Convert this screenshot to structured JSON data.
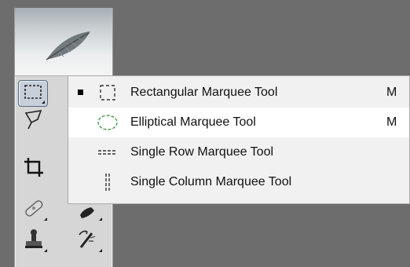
{
  "menu": {
    "items": [
      {
        "label": "Rectangular Marquee Tool",
        "shortcut": "M",
        "active": true
      },
      {
        "label": "Elliptical Marquee Tool",
        "shortcut": "M",
        "active": false
      },
      {
        "label": "Single Row Marquee Tool",
        "shortcut": "",
        "active": false
      },
      {
        "label": "Single Column Marquee Tool",
        "shortcut": "",
        "active": false
      }
    ]
  },
  "toolbar": {
    "logo_icon": "feather-icon",
    "tools": [
      "rectangular-marquee-icon",
      "lasso-icon",
      "crop-icon",
      "healing-brush-icon",
      "brush-icon",
      "clone-stamp-icon",
      "history-brush-icon"
    ]
  },
  "colors": {
    "background": "#6d6d6d",
    "panel": "#d6d6d6",
    "menu": "#f1f1f1",
    "highlight": "#ffffff",
    "selected_tool": "#c7cfd9"
  }
}
